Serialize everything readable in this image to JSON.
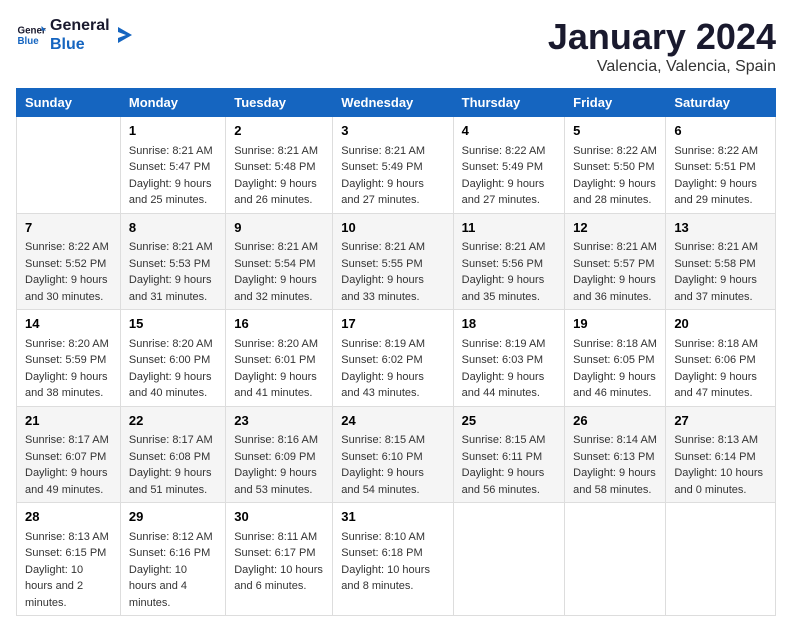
{
  "header": {
    "logo_general": "General",
    "logo_blue": "Blue",
    "main_title": "January 2024",
    "subtitle": "Valencia, Valencia, Spain"
  },
  "calendar": {
    "days_of_week": [
      "Sunday",
      "Monday",
      "Tuesday",
      "Wednesday",
      "Thursday",
      "Friday",
      "Saturday"
    ],
    "weeks": [
      [
        {
          "day": "",
          "empty": true
        },
        {
          "day": "1",
          "sunrise": "Sunrise: 8:21 AM",
          "sunset": "Sunset: 5:47 PM",
          "daylight": "Daylight: 9 hours and 25 minutes."
        },
        {
          "day": "2",
          "sunrise": "Sunrise: 8:21 AM",
          "sunset": "Sunset: 5:48 PM",
          "daylight": "Daylight: 9 hours and 26 minutes."
        },
        {
          "day": "3",
          "sunrise": "Sunrise: 8:21 AM",
          "sunset": "Sunset: 5:49 PM",
          "daylight": "Daylight: 9 hours and 27 minutes."
        },
        {
          "day": "4",
          "sunrise": "Sunrise: 8:22 AM",
          "sunset": "Sunset: 5:49 PM",
          "daylight": "Daylight: 9 hours and 27 minutes."
        },
        {
          "day": "5",
          "sunrise": "Sunrise: 8:22 AM",
          "sunset": "Sunset: 5:50 PM",
          "daylight": "Daylight: 9 hours and 28 minutes."
        },
        {
          "day": "6",
          "sunrise": "Sunrise: 8:22 AM",
          "sunset": "Sunset: 5:51 PM",
          "daylight": "Daylight: 9 hours and 29 minutes."
        }
      ],
      [
        {
          "day": "7",
          "sunrise": "Sunrise: 8:22 AM",
          "sunset": "Sunset: 5:52 PM",
          "daylight": "Daylight: 9 hours and 30 minutes."
        },
        {
          "day": "8",
          "sunrise": "Sunrise: 8:21 AM",
          "sunset": "Sunset: 5:53 PM",
          "daylight": "Daylight: 9 hours and 31 minutes."
        },
        {
          "day": "9",
          "sunrise": "Sunrise: 8:21 AM",
          "sunset": "Sunset: 5:54 PM",
          "daylight": "Daylight: 9 hours and 32 minutes."
        },
        {
          "day": "10",
          "sunrise": "Sunrise: 8:21 AM",
          "sunset": "Sunset: 5:55 PM",
          "daylight": "Daylight: 9 hours and 33 minutes."
        },
        {
          "day": "11",
          "sunrise": "Sunrise: 8:21 AM",
          "sunset": "Sunset: 5:56 PM",
          "daylight": "Daylight: 9 hours and 35 minutes."
        },
        {
          "day": "12",
          "sunrise": "Sunrise: 8:21 AM",
          "sunset": "Sunset: 5:57 PM",
          "daylight": "Daylight: 9 hours and 36 minutes."
        },
        {
          "day": "13",
          "sunrise": "Sunrise: 8:21 AM",
          "sunset": "Sunset: 5:58 PM",
          "daylight": "Daylight: 9 hours and 37 minutes."
        }
      ],
      [
        {
          "day": "14",
          "sunrise": "Sunrise: 8:20 AM",
          "sunset": "Sunset: 5:59 PM",
          "daylight": "Daylight: 9 hours and 38 minutes."
        },
        {
          "day": "15",
          "sunrise": "Sunrise: 8:20 AM",
          "sunset": "Sunset: 6:00 PM",
          "daylight": "Daylight: 9 hours and 40 minutes."
        },
        {
          "day": "16",
          "sunrise": "Sunrise: 8:20 AM",
          "sunset": "Sunset: 6:01 PM",
          "daylight": "Daylight: 9 hours and 41 minutes."
        },
        {
          "day": "17",
          "sunrise": "Sunrise: 8:19 AM",
          "sunset": "Sunset: 6:02 PM",
          "daylight": "Daylight: 9 hours and 43 minutes."
        },
        {
          "day": "18",
          "sunrise": "Sunrise: 8:19 AM",
          "sunset": "Sunset: 6:03 PM",
          "daylight": "Daylight: 9 hours and 44 minutes."
        },
        {
          "day": "19",
          "sunrise": "Sunrise: 8:18 AM",
          "sunset": "Sunset: 6:05 PM",
          "daylight": "Daylight: 9 hours and 46 minutes."
        },
        {
          "day": "20",
          "sunrise": "Sunrise: 8:18 AM",
          "sunset": "Sunset: 6:06 PM",
          "daylight": "Daylight: 9 hours and 47 minutes."
        }
      ],
      [
        {
          "day": "21",
          "sunrise": "Sunrise: 8:17 AM",
          "sunset": "Sunset: 6:07 PM",
          "daylight": "Daylight: 9 hours and 49 minutes."
        },
        {
          "day": "22",
          "sunrise": "Sunrise: 8:17 AM",
          "sunset": "Sunset: 6:08 PM",
          "daylight": "Daylight: 9 hours and 51 minutes."
        },
        {
          "day": "23",
          "sunrise": "Sunrise: 8:16 AM",
          "sunset": "Sunset: 6:09 PM",
          "daylight": "Daylight: 9 hours and 53 minutes."
        },
        {
          "day": "24",
          "sunrise": "Sunrise: 8:15 AM",
          "sunset": "Sunset: 6:10 PM",
          "daylight": "Daylight: 9 hours and 54 minutes."
        },
        {
          "day": "25",
          "sunrise": "Sunrise: 8:15 AM",
          "sunset": "Sunset: 6:11 PM",
          "daylight": "Daylight: 9 hours and 56 minutes."
        },
        {
          "day": "26",
          "sunrise": "Sunrise: 8:14 AM",
          "sunset": "Sunset: 6:13 PM",
          "daylight": "Daylight: 9 hours and 58 minutes."
        },
        {
          "day": "27",
          "sunrise": "Sunrise: 8:13 AM",
          "sunset": "Sunset: 6:14 PM",
          "daylight": "Daylight: 10 hours and 0 minutes."
        }
      ],
      [
        {
          "day": "28",
          "sunrise": "Sunrise: 8:13 AM",
          "sunset": "Sunset: 6:15 PM",
          "daylight": "Daylight: 10 hours and 2 minutes."
        },
        {
          "day": "29",
          "sunrise": "Sunrise: 8:12 AM",
          "sunset": "Sunset: 6:16 PM",
          "daylight": "Daylight: 10 hours and 4 minutes."
        },
        {
          "day": "30",
          "sunrise": "Sunrise: 8:11 AM",
          "sunset": "Sunset: 6:17 PM",
          "daylight": "Daylight: 10 hours and 6 minutes."
        },
        {
          "day": "31",
          "sunrise": "Sunrise: 8:10 AM",
          "sunset": "Sunset: 6:18 PM",
          "daylight": "Daylight: 10 hours and 8 minutes."
        },
        {
          "day": "",
          "empty": true
        },
        {
          "day": "",
          "empty": true
        },
        {
          "day": "",
          "empty": true
        }
      ]
    ]
  }
}
